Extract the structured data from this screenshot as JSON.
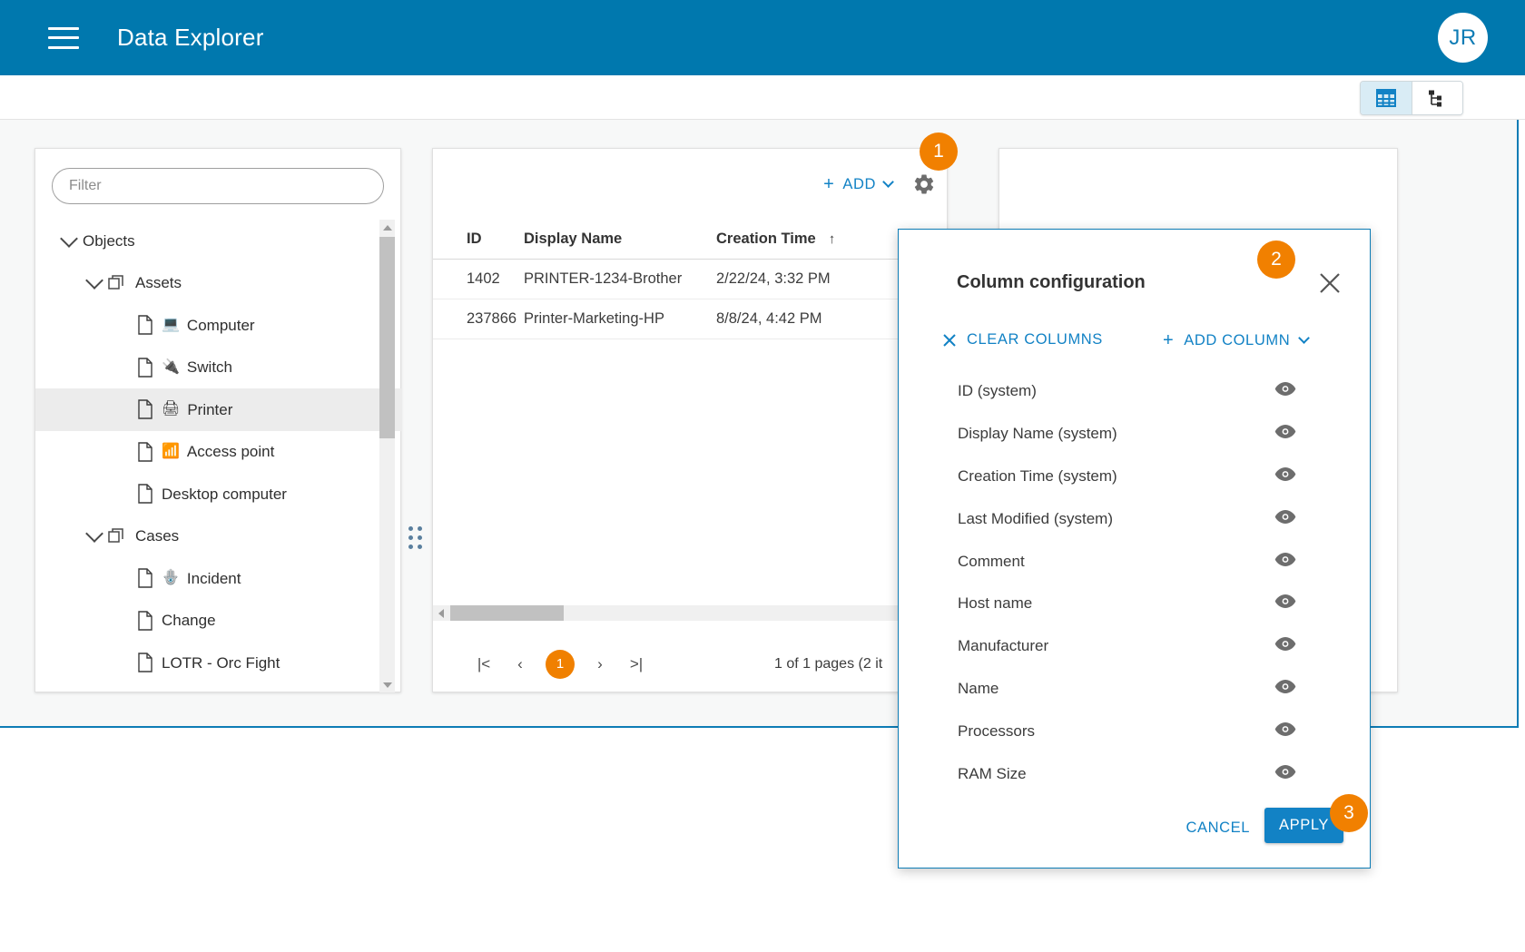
{
  "appbar": {
    "title": "Data Explorer",
    "menu_icon": "hamburger-icon",
    "avatar_initials": "JR",
    "brand_color": "#0078ae"
  },
  "subbar": {
    "views": [
      {
        "id": "grid",
        "icon": "grid-view-icon",
        "active": true
      },
      {
        "id": "tree",
        "icon": "tree-view-icon",
        "active": false
      }
    ]
  },
  "tree_panel": {
    "filter": {
      "value": "",
      "placeholder": "Filter"
    },
    "items": [
      {
        "label": "Objects",
        "level": 0,
        "chevron": "down",
        "icon": null,
        "emoji": "",
        "selected": false
      },
      {
        "label": "Assets",
        "level": 1,
        "chevron": "down",
        "icon": "stack",
        "emoji": "",
        "selected": false
      },
      {
        "label": "Computer",
        "level": 2,
        "chevron": null,
        "icon": "document",
        "emoji": "💻",
        "selected": false
      },
      {
        "label": "Switch",
        "level": 2,
        "chevron": null,
        "icon": "document",
        "emoji": "🔌",
        "selected": false
      },
      {
        "label": "Printer",
        "level": 2,
        "chevron": null,
        "icon": "document",
        "emoji": "🖨",
        "selected": true
      },
      {
        "label": "Access point",
        "level": 2,
        "chevron": null,
        "icon": "document",
        "emoji": "📶",
        "selected": false
      },
      {
        "label": "Desktop computer",
        "level": 2,
        "chevron": null,
        "icon": "document",
        "emoji": "",
        "selected": false
      },
      {
        "label": "Cases",
        "level": 1,
        "chevron": "down",
        "icon": "stack",
        "emoji": "",
        "selected": false
      },
      {
        "label": "Incident",
        "level": 2,
        "chevron": null,
        "icon": "document",
        "emoji": "🪬",
        "selected": false
      },
      {
        "label": "Change",
        "level": 2,
        "chevron": null,
        "icon": "document",
        "emoji": "",
        "selected": false
      },
      {
        "label": "LOTR - Orc Fight",
        "level": 2,
        "chevron": null,
        "icon": "document",
        "emoji": "",
        "selected": false
      }
    ]
  },
  "table_panel": {
    "add_label": "ADD",
    "settings_icon": "gear-icon",
    "columns": [
      "ID",
      "Display Name",
      "Creation Time"
    ],
    "sort_indicator": "↑",
    "rows": [
      {
        "id": "1402",
        "display_name": "PRINTER-1234-Brother",
        "creation_time": "2/22/24, 3:32 PM"
      },
      {
        "id": "237866",
        "display_name": "Printer-Marketing-HP",
        "creation_time": "8/8/24, 4:42 PM"
      }
    ],
    "pagination": {
      "first": "|<",
      "prev": "‹",
      "current_page": "1",
      "next": "›",
      "last": ">|",
      "info": "1 of 1 pages (2 it"
    }
  },
  "dialog": {
    "title": "Column configuration",
    "close_icon": "close-icon",
    "clear_columns_label": "CLEAR COLUMNS",
    "add_column_label": "ADD COLUMN",
    "columns": [
      {
        "label": "ID (system)",
        "visible": true
      },
      {
        "label": "Display Name (system)",
        "visible": true
      },
      {
        "label": "Creation Time (system)",
        "visible": true
      },
      {
        "label": "Last Modified (system)",
        "visible": true
      },
      {
        "label": "Comment",
        "visible": true
      },
      {
        "label": "Host name",
        "visible": true
      },
      {
        "label": "Manufacturer",
        "visible": true
      },
      {
        "label": "Name",
        "visible": true
      },
      {
        "label": "Processors",
        "visible": true
      },
      {
        "label": "RAM Size",
        "visible": true
      }
    ],
    "cancel_label": "CANCEL",
    "apply_label": "APPLY"
  },
  "step_badges": [
    {
      "number": "1"
    },
    {
      "number": "2"
    },
    {
      "number": "3"
    }
  ],
  "colors": {
    "accent_blue": "#1282c5",
    "header_blue": "#0078ae",
    "badge_orange": "#f18000"
  }
}
